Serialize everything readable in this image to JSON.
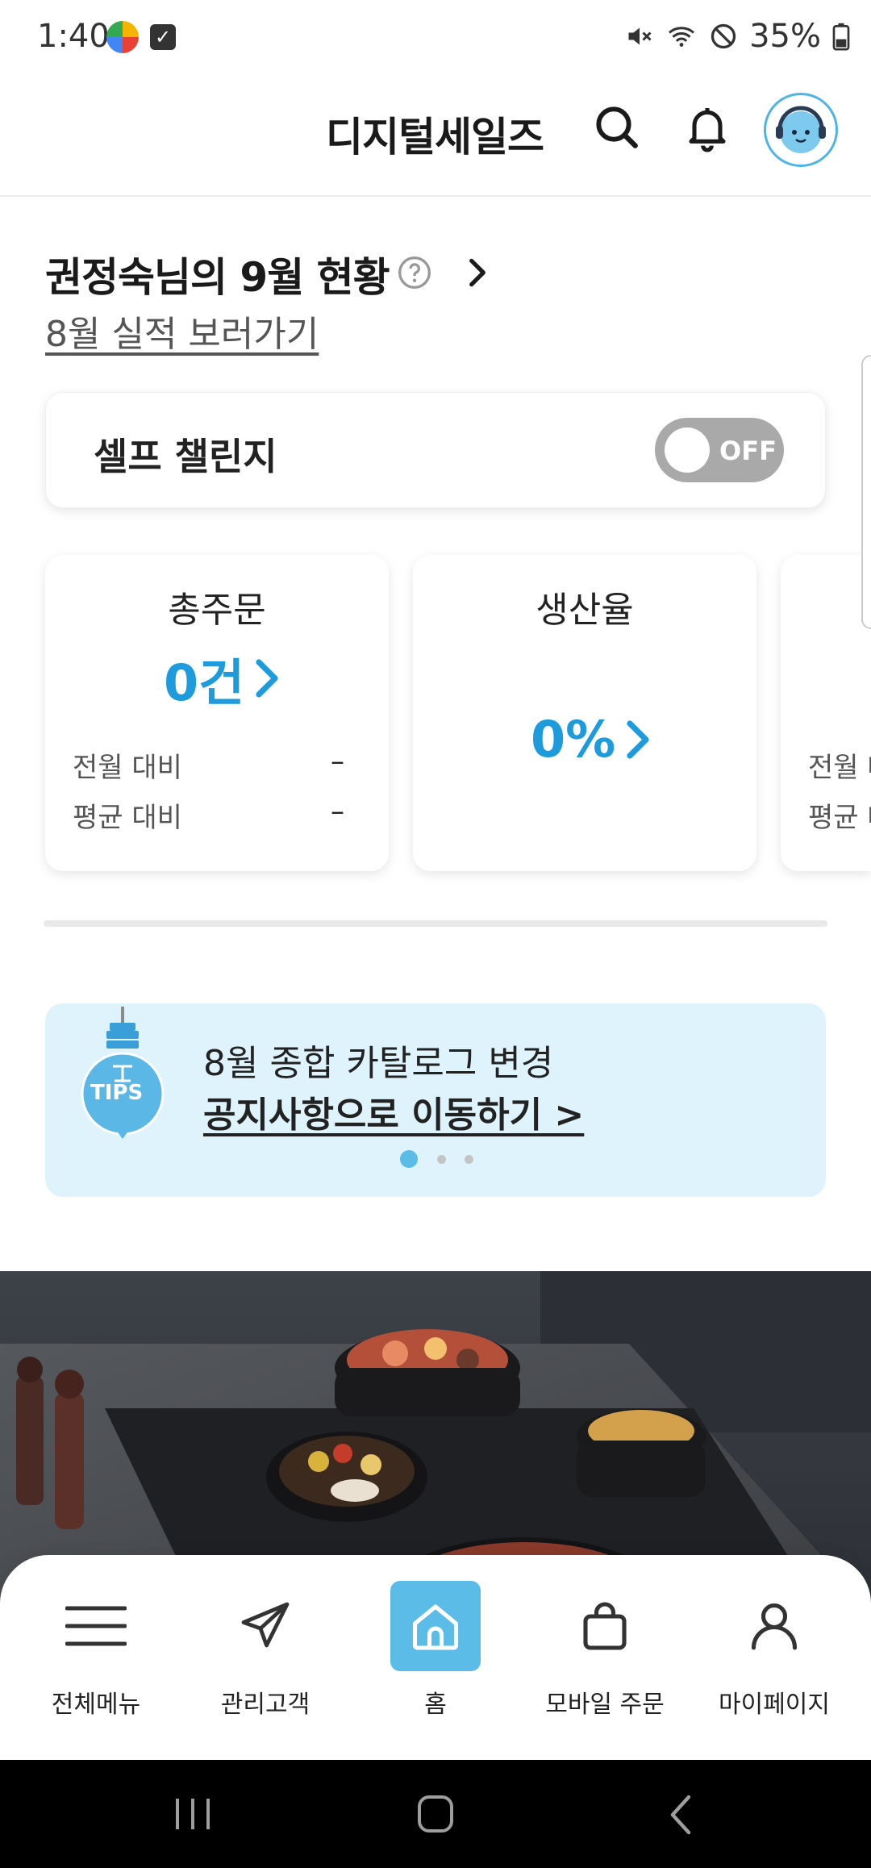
{
  "status_bar": {
    "time": "1:40",
    "battery": "35%"
  },
  "header": {
    "title": "디지털세일즈"
  },
  "status_section": {
    "title": "권정숙님의 9월 현황",
    "prev_link": "8월 실적 보러가기"
  },
  "challenge": {
    "label": "셀프 챌린지",
    "toggle_text": "OFF"
  },
  "cards": [
    {
      "title": "총주문",
      "value": "0건",
      "row1_label": "전월 대비",
      "row1_value": "–",
      "row2_label": "평균 대비",
      "row2_value": "–"
    },
    {
      "title": "생산율",
      "value": "0%"
    },
    {
      "row1_label": "전월 대",
      "row2_label": "평균 대"
    }
  ],
  "tips": {
    "badge": "TIPS",
    "line1": "8월 종합 카탈로그 변경",
    "line2": "공지사항으로 이동하기 >"
  },
  "bottom_nav": [
    {
      "label": "전체메뉴",
      "icon": "menu-icon"
    },
    {
      "label": "관리고객",
      "icon": "paper-plane-icon"
    },
    {
      "label": "홈",
      "icon": "home-icon"
    },
    {
      "label": "모바일 주문",
      "icon": "shopping-bag-icon"
    },
    {
      "label": "마이페이지",
      "icon": "person-icon"
    }
  ],
  "colors": {
    "accent": "#1e9bdc",
    "tips_bg": "#def3fc",
    "home_active": "#5bbce8"
  }
}
